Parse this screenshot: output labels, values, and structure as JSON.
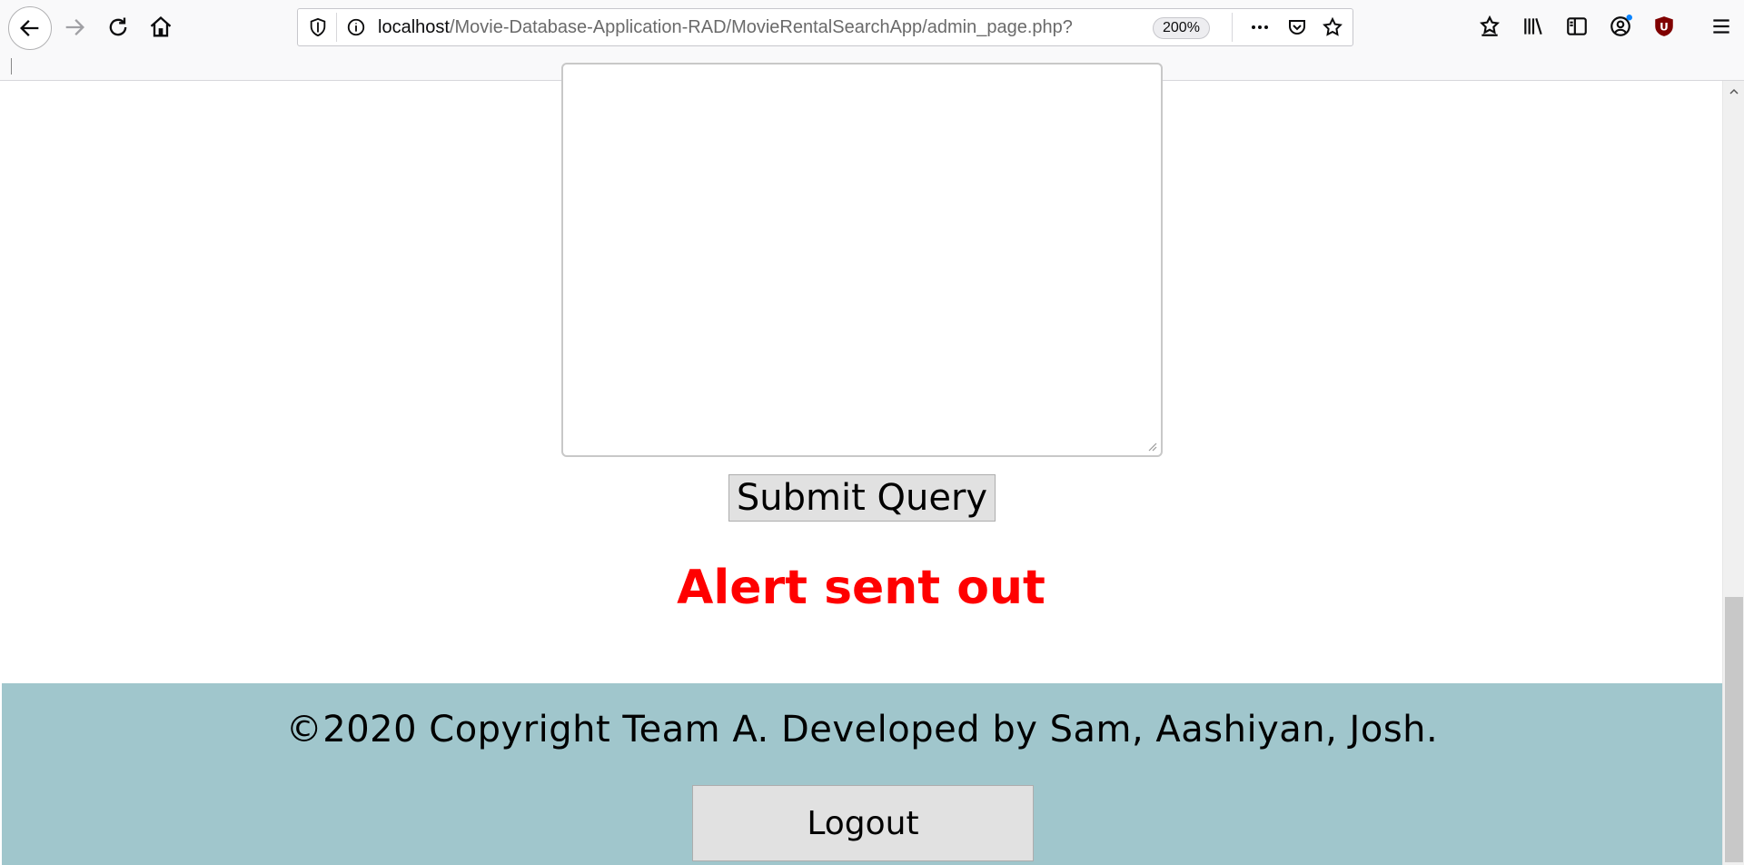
{
  "browser": {
    "url_host": "localhost",
    "url_path": "/Movie-Database-Application-RAD/MovieRentalSearchApp/admin_page.php?",
    "zoom": "200%",
    "extension_badge": "U",
    "accent_color": "#0a84ff"
  },
  "form": {
    "query_text": "",
    "submit_label": "Submit Query"
  },
  "alert": {
    "message": "Alert sent out",
    "color": "#ff0000"
  },
  "footer": {
    "copyright": "©2020 Copyright Team A. Developed by Sam, Aashiyan, Josh.",
    "logout_label": "Logout",
    "background": "#a0c6cc"
  }
}
